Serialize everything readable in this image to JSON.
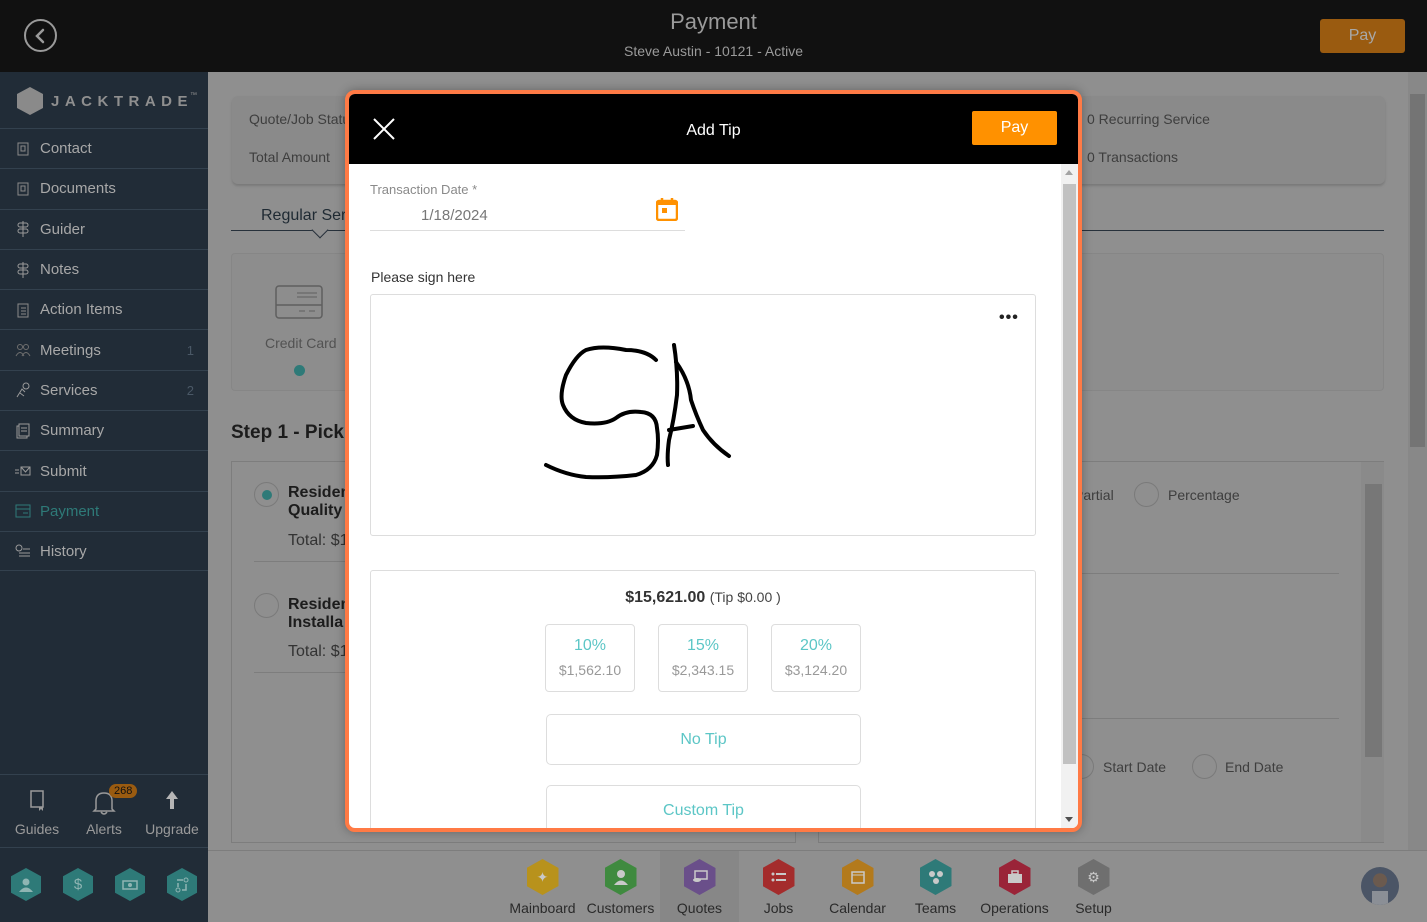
{
  "header": {
    "title": "Payment",
    "subtitle": "Steve Austin - 10121 - Active",
    "pay_label": "Pay"
  },
  "brand": {
    "name": "JACKTRADE",
    "trademark": "™"
  },
  "sidebar": {
    "items": [
      {
        "label": "Contact",
        "icon": "contact-book-icon",
        "count": ""
      },
      {
        "label": "Documents",
        "icon": "documents-icon",
        "count": ""
      },
      {
        "label": "Guider",
        "icon": "signpost-icon",
        "count": ""
      },
      {
        "label": "Notes",
        "icon": "signpost-icon",
        "count": ""
      },
      {
        "label": "Action Items",
        "icon": "clipboard-icon",
        "count": ""
      },
      {
        "label": "Meetings",
        "icon": "meetings-icon",
        "count": "1"
      },
      {
        "label": "Services",
        "icon": "services-icon",
        "count": "2"
      },
      {
        "label": "Summary",
        "icon": "summary-icon",
        "count": ""
      },
      {
        "label": "Submit",
        "icon": "submit-icon",
        "count": ""
      },
      {
        "label": "Payment",
        "icon": "payment-icon",
        "count": "",
        "active": true
      },
      {
        "label": "History",
        "icon": "history-icon",
        "count": ""
      }
    ],
    "tools": [
      {
        "label": "Guides",
        "icon": "book-icon"
      },
      {
        "label": "Alerts",
        "icon": "bell-icon",
        "badge": "268"
      },
      {
        "label": "Upgrade",
        "icon": "arrow-up-icon"
      }
    ],
    "quick_icons": [
      "person-icon",
      "dollar-icon",
      "money-icon",
      "workflow-icon"
    ]
  },
  "background": {
    "status_label": "Quote/Job Status",
    "total_label": "Total Amount",
    "recurring": "0 Recurring Service",
    "transactions": "0 Transactions",
    "tab_label": "Regular Service",
    "payment_method": "Credit Card",
    "step_title": "Step 1 - Pick",
    "options": [
      {
        "line1": "Residential",
        "line2": "Quality",
        "total": "Total: $1",
        "selected": true
      },
      {
        "line1": "Residential",
        "line2": "Installa",
        "total": "Total: $1",
        "selected": false
      }
    ],
    "right_options": [
      "Partial",
      "Percentage"
    ],
    "date_options": [
      "Start Date",
      "End Date"
    ]
  },
  "modal": {
    "title": "Add Tip",
    "pay_label": "Pay",
    "date_label": "Transaction Date *",
    "date_value": "1/18/2024",
    "sign_label": "Please sign here",
    "signature_text": "SA",
    "more_label": "•••",
    "total_amount": "$15,621.00",
    "tip_text": "(Tip $0.00 )",
    "tip_options": [
      {
        "percent": "10%",
        "amount": "$1,562.10"
      },
      {
        "percent": "15%",
        "amount": "$2,343.15"
      },
      {
        "percent": "20%",
        "amount": "$3,124.20"
      }
    ],
    "no_tip_label": "No Tip",
    "custom_tip_label": "Custom Tip"
  },
  "bottom_nav": [
    {
      "label": "Mainboard",
      "icon": "mainboard-icon",
      "color": "#b8921c"
    },
    {
      "label": "Customers",
      "icon": "customers-icon",
      "color": "#3f8a3f"
    },
    {
      "label": "Quotes",
      "icon": "quotes-icon",
      "color": "#6a4f8a",
      "selected": true
    },
    {
      "label": "Jobs",
      "icon": "jobs-icon",
      "color": "#a42c2c"
    },
    {
      "label": "Calendar",
      "icon": "calendar-icon",
      "color": "#b37a1c"
    },
    {
      "label": "Teams",
      "icon": "teams-icon",
      "color": "#2e7a78"
    },
    {
      "label": "Operations",
      "icon": "operations-icon",
      "color": "#9a2438"
    },
    {
      "label": "Setup",
      "icon": "setup-gear-icon",
      "color": "#6f6f6f"
    }
  ],
  "colors": {
    "accent_orange": "#ff9100",
    "modal_border": "#ff7a45",
    "teal": "#5cc6c6",
    "active_nav": "#2e7a78"
  }
}
